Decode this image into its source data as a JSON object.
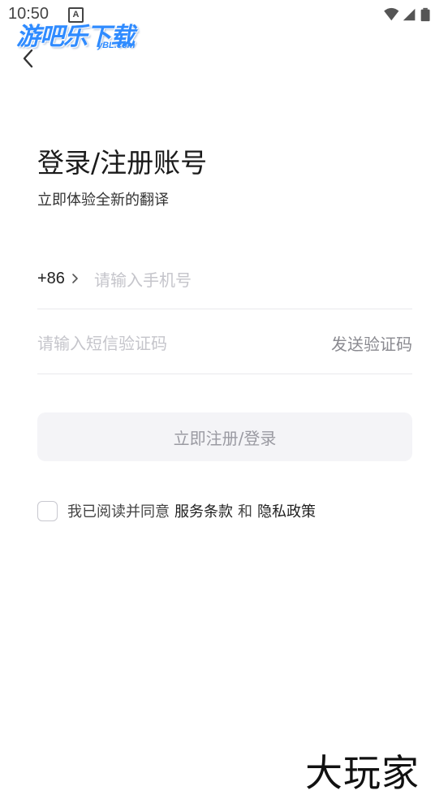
{
  "status_bar": {
    "time": "10:50",
    "notification_badge": "A",
    "icons": [
      "wifi-icon",
      "signal-icon",
      "battery-icon"
    ]
  },
  "watermark_logo": {
    "main": "游吧乐下载",
    "sub": "yBL.com"
  },
  "header": {
    "back_icon": "chevron-left-icon"
  },
  "title": "登录/注册账号",
  "subtitle": "立即体验全新的翻译",
  "phone": {
    "country_code": "+86",
    "chevron_icon": "chevron-right-icon",
    "placeholder": "请输入手机号",
    "value": ""
  },
  "verification": {
    "placeholder": "请输入短信验证码",
    "value": "",
    "send_label": "发送验证码"
  },
  "submit_label": "立即注册/登录",
  "agreement": {
    "checked": false,
    "prefix": "我已阅读并同意",
    "terms_link": "服务条款",
    "conjunction": "和",
    "privacy_link": "隐私政策"
  },
  "bottom_watermark": "大玩家",
  "colors": {
    "logo_blue": "#2f8bff",
    "placeholder": "#c5c5cb",
    "button_bg": "#f4f4f7",
    "button_text": "#9a9aa2"
  }
}
